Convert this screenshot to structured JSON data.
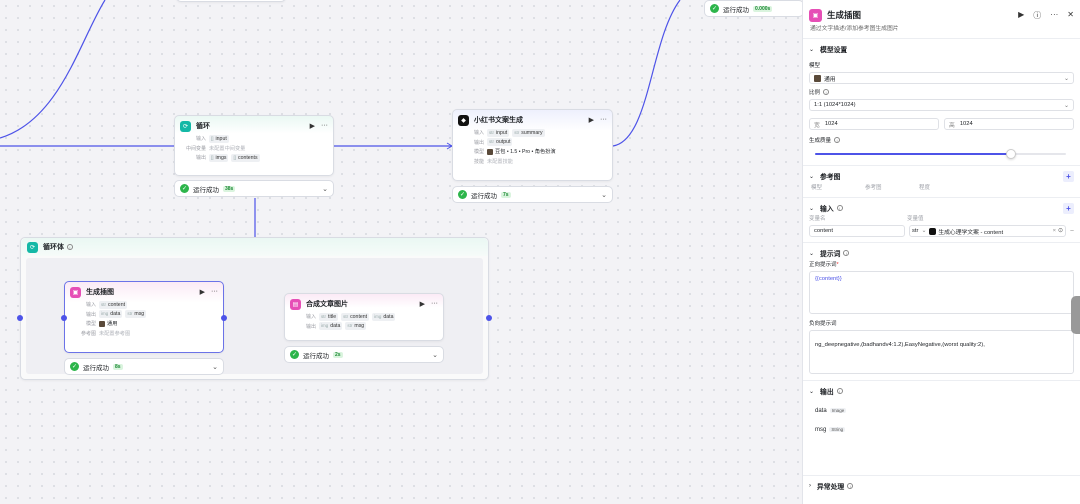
{
  "canvas": {
    "top_status": {
      "label": "运行成功",
      "duration": "0.000s"
    },
    "loop": {
      "title": "循环",
      "rows": [
        {
          "label": "输入",
          "tags": [
            {
              "t": "[]",
              "v": "input"
            }
          ]
        },
        {
          "label": "中间变量",
          "gray": "未配置中间变量"
        },
        {
          "label": "输出",
          "tags": [
            {
              "t": "[]",
              "v": "imgs"
            },
            {
              "t": "[]",
              "v": "contents"
            }
          ]
        }
      ],
      "status": "运行成功",
      "duration": "38s"
    },
    "xhs": {
      "title": "小红书文案生成",
      "rows": [
        {
          "label": "输入",
          "tags": [
            {
              "t": "str",
              "v": "input"
            },
            {
              "t": "str",
              "v": "summary"
            }
          ]
        },
        {
          "label": "输出",
          "tags": [
            {
              "t": "str",
              "v": "output"
            }
          ]
        },
        {
          "label": "模型",
          "model": "豆包 • 1.5 • Pro • 角色扮演"
        },
        {
          "label": "技能",
          "gray": "未配置技能"
        }
      ],
      "status": "运行成功",
      "duration": "7s"
    },
    "loopbody": {
      "title": "循环体"
    },
    "genimg": {
      "title": "生成插图",
      "rows": [
        {
          "label": "输入",
          "tags": [
            {
              "t": "str",
              "v": "content"
            }
          ]
        },
        {
          "label": "输出",
          "tags": [
            {
              "t": "img",
              "v": "data"
            },
            {
              "t": "str",
              "v": "msg"
            }
          ]
        },
        {
          "label": "模型",
          "model": "通用"
        },
        {
          "label": "参考图",
          "gray": "未配置参考图"
        }
      ],
      "status": "运行成功",
      "duration": "8s"
    },
    "compose": {
      "title": "合成文章图片",
      "rows": [
        {
          "label": "输入",
          "tags": [
            {
              "t": "str",
              "v": "title"
            },
            {
              "t": "str",
              "v": "content"
            },
            {
              "t": "img",
              "v": "data"
            }
          ]
        },
        {
          "label": "输出",
          "tags": [
            {
              "t": "img",
              "v": "data"
            },
            {
              "t": "str",
              "v": "msg"
            }
          ]
        }
      ],
      "status": "运行成功",
      "duration": "2s"
    }
  },
  "panel": {
    "title": "生成插图",
    "desc": "通过文字描述/添加参考图生成图片",
    "model_section": "模型设置",
    "model_label": "模型",
    "model_value": "通用",
    "ratio_label": "比例",
    "ratio_value": "1:1 (1024*1024)",
    "width_prefix": "宽",
    "width_value": "1024",
    "height_prefix": "高",
    "height_value": "1024",
    "quality_label": "生成质量",
    "quality": 0.78,
    "ref_section": "参考图",
    "ref_cols": [
      "模型",
      "参考图",
      "程度"
    ],
    "input_section": "输入",
    "var_name_label": "变量名",
    "var_value_label": "变量值",
    "var_name": "content",
    "var_type": "str",
    "var_ref": "生成心理学文案 - content",
    "prompt_section": "提示词",
    "pos_label": "正向提示词",
    "pos_value": "{{content}}",
    "neg_label": "负向提示词",
    "neg_value": "ng_deepnegative,(badhandv4:1.2),EasyNegative,(worst quality:2),",
    "output_section": "输出",
    "outputs": [
      {
        "name": "data",
        "type": "Image"
      },
      {
        "name": "msg",
        "type": "String"
      }
    ],
    "error_section": "异常处理"
  },
  "colors": {
    "accent": "#4d53e8",
    "success": "#2db54b",
    "loop_icon": "#14b8a6",
    "img_icon": "#e64fb6"
  }
}
